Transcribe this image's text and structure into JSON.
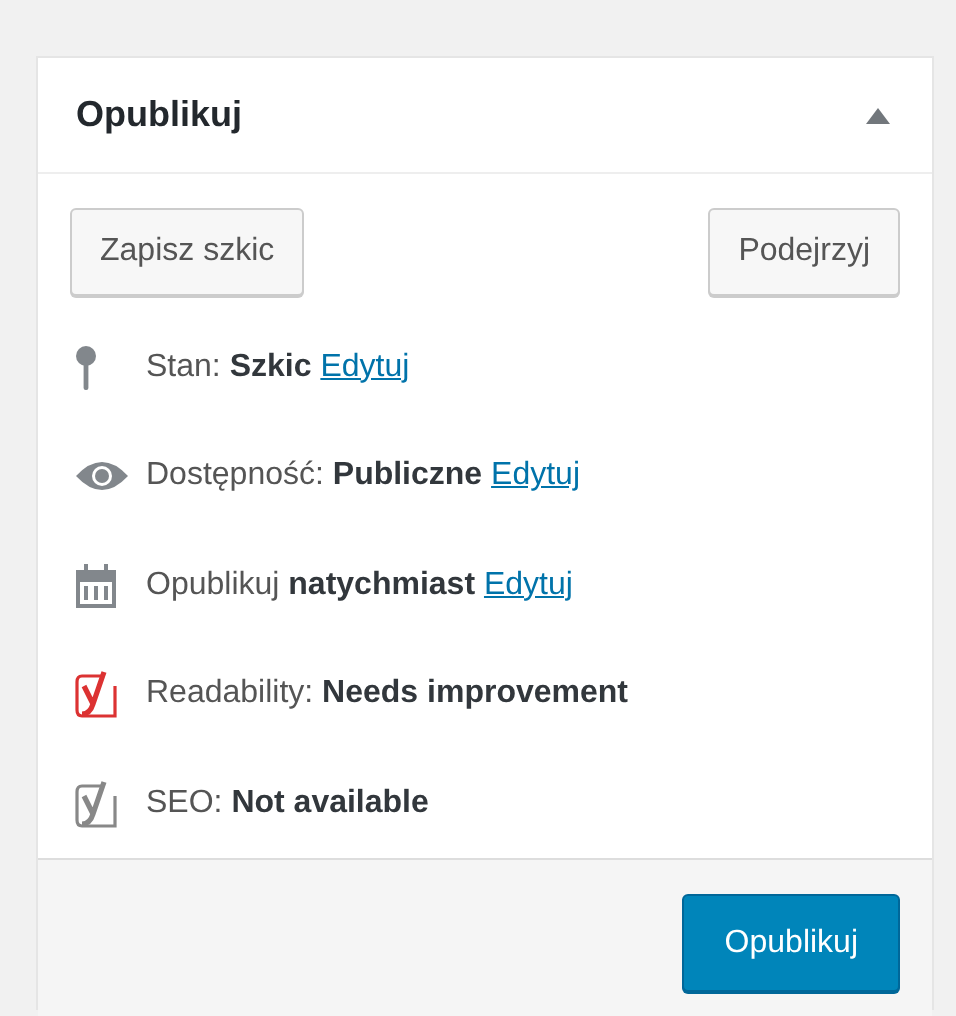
{
  "panel": {
    "title": "Opublikuj",
    "expanded": true
  },
  "buttons": [
    {
      "label": "Zapisz szkic"
    },
    {
      "label": "Podejrzyj"
    }
  ],
  "rows": [
    {
      "kind": "pin",
      "text": "Stan: **Szkic**",
      "link": "Edytuj"
    },
    {
      "kind": "eye",
      "text": "Dostępność: **Publiczne**",
      "link": "Edytuj"
    },
    {
      "kind": "calendar",
      "text": "Opublikuj **natychmiast**",
      "link": "Edytuj"
    },
    {
      "kind": "yoast",
      "color": "#dc3232",
      "text": "Readability: **Needs improvement**"
    },
    {
      "kind": "yoast",
      "color": "#888888",
      "text": "SEO: **Not available**"
    }
  ],
  "publish_button": {
    "label": "Opublikuj"
  }
}
